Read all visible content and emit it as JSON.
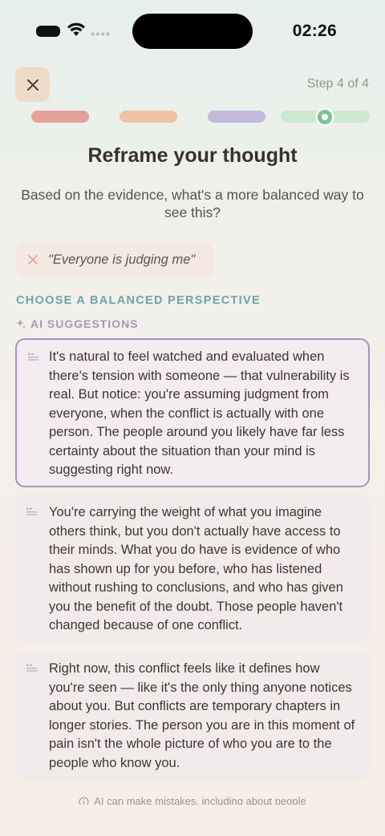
{
  "status_bar": {
    "time": "02:26"
  },
  "header": {
    "step_label": "Step 4 of 4"
  },
  "progress": {
    "total_steps": 4,
    "current_step": 4
  },
  "title": "Reframe your thought",
  "subtitle": "Based on the evidence, what's a more balanced way to see this?",
  "thought": "\"Everyone is judging me\"",
  "section_label": "CHOOSE A BALANCED PERSPECTIVE",
  "ai_label": "AI SUGGESTIONS",
  "suggestions": [
    {
      "text": "It's natural to feel watched and evaluated when there's tension with someone — that vulnerability is real. But notice: you're assuming judgment from everyone, when the conflict is actually with one person. The people around you likely have far less certainty about the situation than your mind is suggesting right now.",
      "selected": true
    },
    {
      "text": "You're carrying the weight of what you imagine others think, but you don't actually have access to their minds. What you do have is evidence of who has shown up for you before, who has listened without rushing to conclusions, and who has given you the benefit of the doubt. Those people haven't changed because of one conflict.",
      "selected": false
    },
    {
      "text": "Right now, this conflict feels like it defines how you're seen — like it's the only thing anyone notices about you. But conflicts are temporary chapters in longer stories. The person you are in this moment of pain isn't the whole picture of who you are to the people who know you.",
      "selected": false
    }
  ],
  "disclaimer": "AI can make mistakes, including about people",
  "colors": {
    "progress_1": "#e5a19b",
    "progress_2": "#edc3a1",
    "progress_3": "#c3b9dc",
    "progress_4": "#cce8d2",
    "accent_teal": "#6aa6a6",
    "selected_border": "#a494c2",
    "close_bg": "#eddcc8"
  },
  "icons": [
    "signal-icon",
    "wifi-icon",
    "close-icon",
    "sparkle-icon",
    "quote-icon",
    "info-icon"
  ]
}
